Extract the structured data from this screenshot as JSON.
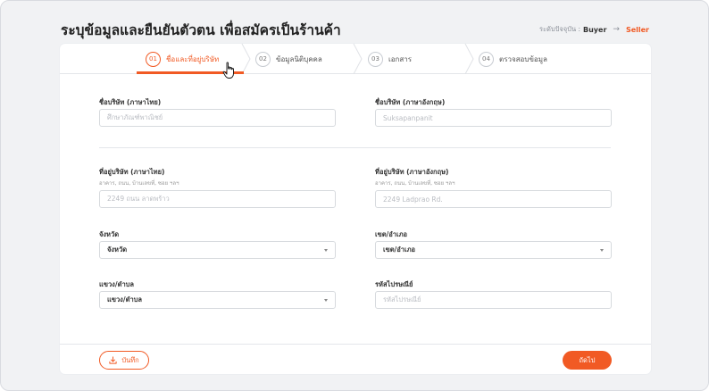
{
  "header": {
    "title": "ระบุข้อมูลและยืนยันตัวตน เพื่อสมัครเป็นร้านค้า",
    "role_prefix": "ระดับปัจจุบัน :",
    "current_role": "Buyer",
    "arrow": "→",
    "next_role": "Seller"
  },
  "steps": [
    {
      "num": "01",
      "label": "ชื่อและที่อยู่บริษัท"
    },
    {
      "num": "02",
      "label": "ข้อมูลนิติบุคคล"
    },
    {
      "num": "03",
      "label": "เอกสาร"
    },
    {
      "num": "04",
      "label": "ตรวจสอบข้อมูล"
    }
  ],
  "form": {
    "company_th": {
      "label": "ชื่อบริษัท (ภาษาไทย)",
      "placeholder": "ศึกษาภัณฑ์พาณิชย์"
    },
    "company_en": {
      "label": "ชื่อบริษัท (ภาษาอังกฤษ)",
      "placeholder": "Suksapanpanit"
    },
    "address_th": {
      "label": "ที่อยู่บริษัท (ภาษาไทย)",
      "hint": "อาคาร, ถนน, บ้านเลขที่, ซอย ฯลฯ",
      "placeholder": "2249 ถนน ลาดพร้าว"
    },
    "address_en": {
      "label": "ที่อยู่บริษัท (ภาษาอังกฤษ)",
      "hint": "อาคาร, ถนน, บ้านเลขที่, ซอย ฯลฯ",
      "placeholder": "2249 Ladprao Rd."
    },
    "province": {
      "label": "จังหวัด",
      "value": "จังหวัด"
    },
    "district": {
      "label": "เขต/อำเภอ",
      "value": "เขต/อำเภอ"
    },
    "subdistrict": {
      "label": "แขวง/ตำบล",
      "value": "แขวง/ตำบล"
    },
    "postcode": {
      "label": "รหัสไปรษณีย์",
      "placeholder": "รหัสไปรษณีย์"
    }
  },
  "footer": {
    "save_label": "บันทึก",
    "next_label": "ถัดไป"
  },
  "colors": {
    "accent": "#f15a24"
  },
  "icons": {
    "save": "download-icon",
    "cursor": "hand-pointer-icon"
  }
}
